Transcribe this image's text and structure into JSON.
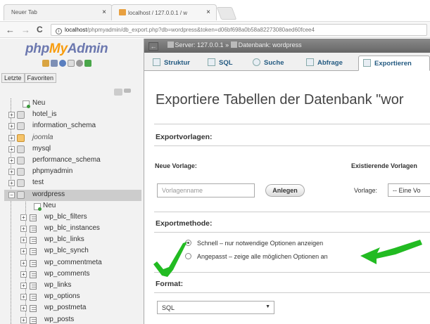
{
  "browser": {
    "tabs": [
      {
        "title": "Neuer Tab",
        "close": "×"
      },
      {
        "title": "localhost / 127.0.0.1 / w",
        "close": "×"
      }
    ],
    "nav": {
      "back": "←",
      "forward": "→",
      "reload": "C"
    },
    "url": {
      "host": "localhost",
      "path": "/phpmyadmin/db_export.php?db=wordpress&token=d06bf698a0b58a82273080aed60fcee4"
    }
  },
  "sidebar": {
    "logo_php": "php",
    "logo_my": "My",
    "logo_admin": "Admin",
    "tabs": [
      "Letzte",
      "Favoriten"
    ],
    "databases": [
      {
        "name": "Neu",
        "kind": "new"
      },
      {
        "name": "hotel_is",
        "kind": "db"
      },
      {
        "name": "information_schema",
        "kind": "db"
      },
      {
        "name": "joomla",
        "kind": "db",
        "italic": true
      },
      {
        "name": "mysql",
        "kind": "db"
      },
      {
        "name": "performance_schema",
        "kind": "db"
      },
      {
        "name": "phpmyadmin",
        "kind": "db"
      },
      {
        "name": "test",
        "kind": "db"
      },
      {
        "name": "wordpress",
        "kind": "db",
        "selected": true
      }
    ],
    "tables": [
      "Neu",
      "wp_blc_filters",
      "wp_blc_instances",
      "wp_blc_links",
      "wp_blc_synch",
      "wp_commentmeta",
      "wp_comments",
      "wp_links",
      "wp_options",
      "wp_postmeta",
      "wp_posts"
    ]
  },
  "main": {
    "breadcrumb": {
      "server": "Server: 127.0.0.1",
      "separator": "»",
      "database": "Datenbank: wordpress"
    },
    "tabs": [
      "Struktur",
      "SQL",
      "Suche",
      "Abfrage",
      "Exportieren"
    ],
    "active_tab": "Exportieren",
    "page_title": "Exportiere Tabellen der Datenbank \"wor",
    "templates": {
      "heading": "Exportvorlagen:",
      "new_label": "Neue Vorlage:",
      "existing_label": "Existierende Vorlagen",
      "name_placeholder": "Vorlagenname",
      "create_button": "Anlegen",
      "template_label": "Vorlage:",
      "template_select": "-- Eine Vo"
    },
    "method": {
      "heading": "Exportmethode:",
      "options": [
        "Schnell – nur notwendige Optionen anzeigen",
        "Angepasst – zeige alle möglichen Optionen an"
      ],
      "selected": 0
    },
    "format": {
      "heading": "Format:",
      "value": "SQL"
    }
  },
  "colors": {
    "annotation_green": "#22bb22",
    "logo_blue": "#6c78af",
    "logo_orange": "#f89c0e"
  }
}
